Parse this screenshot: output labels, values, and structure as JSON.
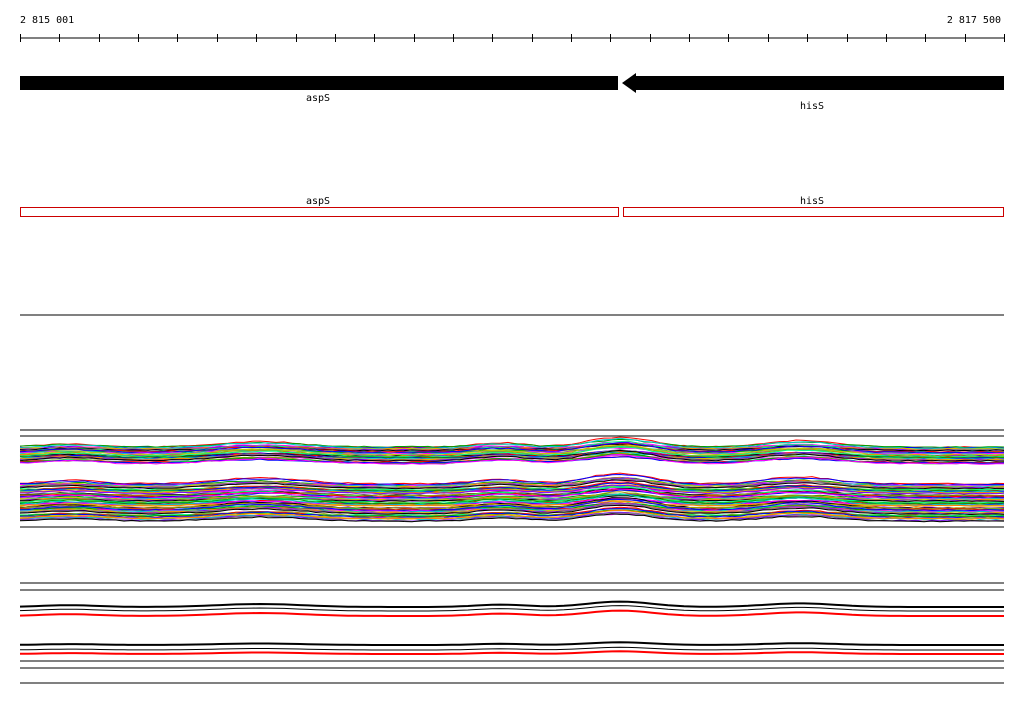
{
  "ruler": {
    "start_label": "2 815 001",
    "end_label": "2 817 500",
    "start": 2815001,
    "end": 2817500,
    "tick_count": 26
  },
  "genes": [
    {
      "name": "aspS",
      "strand": "+",
      "start": 2815001,
      "end": 2816522
    },
    {
      "name": "hisS",
      "strand": "-",
      "start": 2816532,
      "end": 2817500
    }
  ],
  "annotation_track": {
    "outline_color": "#cc0000",
    "boxes": [
      {
        "name": "aspS",
        "start": 2815001,
        "end": 2816522
      },
      {
        "name": "hisS",
        "start": 2816532,
        "end": 2817500
      }
    ]
  },
  "colors": {
    "gene_fill": "#000000",
    "track_lines": "#000000",
    "profile_palette": [
      "#ff0000",
      "#00a000",
      "#0000ff",
      "#ff00ff",
      "#00c8c8",
      "#c8c800",
      "#ff8000",
      "#8000ff",
      "#808080",
      "#000000",
      "#a0a000",
      "#00ff80"
    ],
    "aggregate_primary": "#000000",
    "aggregate_secondary": "#ff0000"
  }
}
